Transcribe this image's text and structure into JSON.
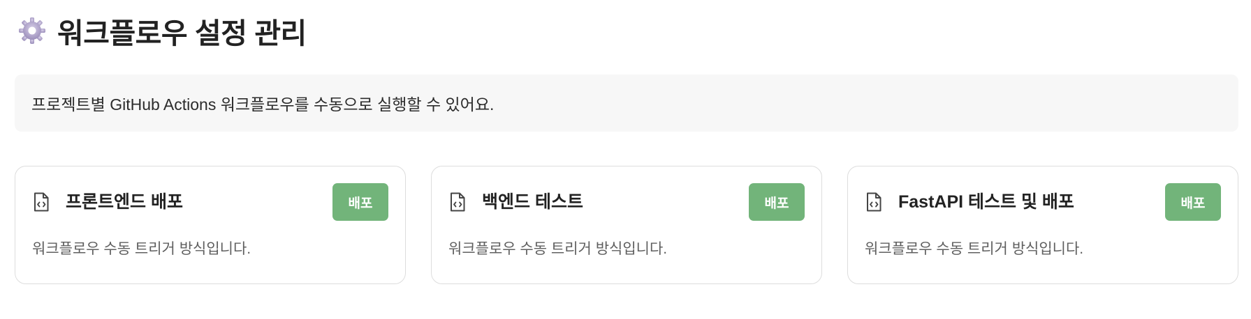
{
  "header": {
    "icon": "gear-icon",
    "title": "워크플로우 설정 관리"
  },
  "info": {
    "text": "프로젝트별 GitHub Actions 워크플로우를 수동으로 실행할 수 있어요."
  },
  "workflows": [
    {
      "icon": "code-file-icon",
      "title": "프론트엔드 배포",
      "button_label": "배포",
      "description": "워크플로우 수동 트리거 방식입니다."
    },
    {
      "icon": "code-file-icon",
      "title": "백엔드 테스트",
      "button_label": "배포",
      "description": "워크플로우 수동 트리거 방식입니다."
    },
    {
      "icon": "code-file-icon",
      "title": "FastAPI 테스트 및 배포",
      "button_label": "배포",
      "description": "워크플로우 수동 트리거 방식입니다."
    }
  ],
  "colors": {
    "button": "#72b47a",
    "info_background": "#f7f7f7",
    "card_border": "#dddddd",
    "gear": "#a99cc4"
  }
}
